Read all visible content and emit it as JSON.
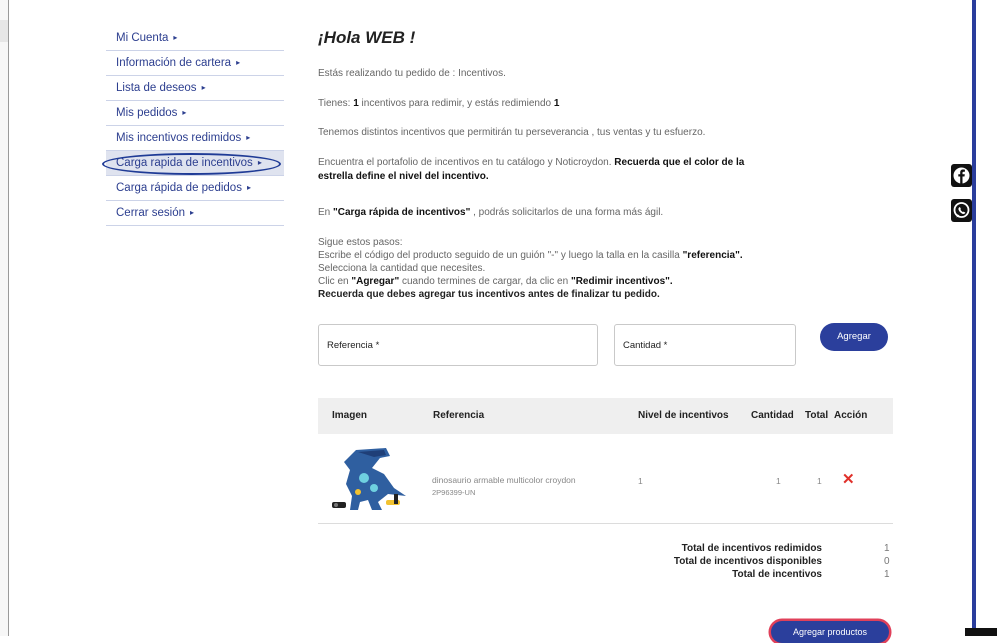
{
  "sidebar": {
    "items": [
      {
        "label": "Mi Cuenta"
      },
      {
        "label": "Información de cartera"
      },
      {
        "label": "Lista de deseos"
      },
      {
        "label": "Mis pedidos"
      },
      {
        "label": "Mis incentivos redimidos"
      },
      {
        "label": "Carga rapida de incentivos"
      },
      {
        "label": "Carga rápida de pedidos"
      },
      {
        "label": "Cerrar sesión"
      }
    ],
    "arrow": "▸"
  },
  "main": {
    "greeting": "¡Hola WEB !",
    "order_prefix": "Estás realizando tu pedido de : ",
    "order_type": "Incentivos.",
    "tienes_1": "Tienes: ",
    "tienes_count": "1",
    "tienes_2": " incentivos para redimir, y estás redimiendo ",
    "tienes_redeeming": "1",
    "incentives_text": "Tenemos distintos incentivos que permitirán tu perseverancia , tus ventas y tu esfuerzo.",
    "portfolio_1": "Encuentra el portafolio de incentivos en tu catálogo y Noticroydon. ",
    "portfolio_bold1": "Recuerda que el color de la",
    "portfolio_bold2": "estrella define el nivel del incentivo.",
    "quick_1": "En ",
    "quick_bold": "\"Carga rápida de incentivos\"",
    "quick_2": " , podrás solicitarlos de una forma más ágil.",
    "steps_title": "Sigue estos pasos:",
    "step1_text": "Escribe el código del producto seguido de un guión \"-\" y luego la talla en la casilla ",
    "step1_bold": "\"referencia\".",
    "step2_text": "Selecciona la cantidad que necesites.",
    "step3_1": "Clic en ",
    "step3_bold1": "\"Agregar\"",
    "step3_2": " cuando termines de cargar, da clic en ",
    "step3_bold2": "\"Redimir incentivos\".",
    "reminder": "Recuerda que debes agregar tus incentivos antes de finalizar tu pedido."
  },
  "form": {
    "referencia_label": "Referencia *",
    "cantidad_label": "Cantidad *",
    "agregar_label": "Agregar"
  },
  "table": {
    "headers": [
      "Imagen",
      "Referencia",
      "Nivel de incentivos",
      "Cantidad",
      "Total",
      "Acción"
    ],
    "rows": [
      {
        "referencia": "dinosaurio armable multicolor croydon",
        "code": "2P96399-UN",
        "nivel": "1",
        "cantidad": "1",
        "total": "1",
        "action": "✕"
      }
    ]
  },
  "totals": {
    "redimidos_label": "Total de incentivos redimidos",
    "redimidos_value": "1",
    "disponibles_label": "Total de incentivos disponibles",
    "disponibles_value": "0",
    "total_label": "Total de incentivos",
    "total_value": "1"
  },
  "footer": {
    "agregar_productos": "Agregar productos"
  },
  "colors": {
    "accent": "#2b3f9c",
    "delete": "#e0302a",
    "highlight": "#e0405a"
  },
  "icons": {
    "facebook": "facebook-icon",
    "whatsapp": "whatsapp-icon"
  }
}
